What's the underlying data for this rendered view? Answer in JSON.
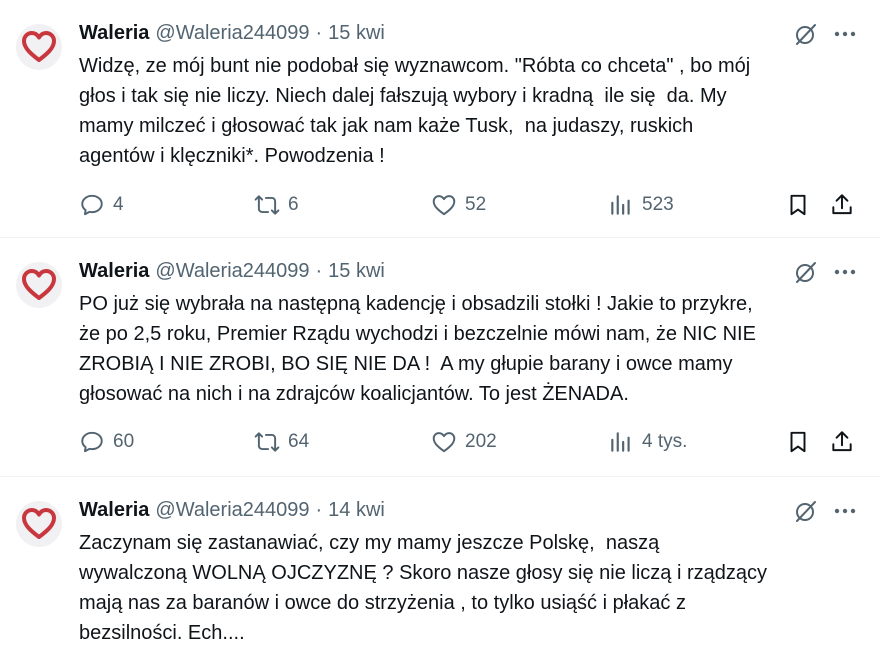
{
  "colors": {
    "text": "#0f1419",
    "muted": "#536471",
    "heart": "#c8373d",
    "divider": "#eff3f4"
  },
  "tweets": [
    {
      "name": "Waleria",
      "handle": "@Waleria244099",
      "separator": "·",
      "date": "15 kwi",
      "text": "Widzę, ze mój bunt nie podobał się wyznawcom. \"Róbta co chceta\" , bo mój\ngłos i tak się nie liczy. Niech dalej fałszują wybory i kradną  ile się  da. My\nmamy milczeć i głosować tak jak nam każe Tusk,  na judaszy, ruskich\nagentów i klęczniki*. Powodzenia !",
      "replies": "4",
      "reposts": "6",
      "likes": "52",
      "views": "523"
    },
    {
      "name": "Waleria",
      "handle": "@Waleria244099",
      "separator": "·",
      "date": "15 kwi",
      "text": "PO już się wybrała na następną kadencję i obsadzili stołki ! Jakie to przykre,\nże po 2,5 roku, Premier Rządu wychodzi i bezczelnie mówi nam, że NIC NIE\nZROBIĄ I NIE ZROBI, BO SIĘ NIE DA !  A my głupie barany i owce mamy\ngłosować na nich i na zdrajców koalicjantów. To jest ŻENADA.",
      "replies": "60",
      "reposts": "64",
      "likes": "202",
      "views": "4 tys."
    },
    {
      "name": "Waleria",
      "handle": "@Waleria244099",
      "separator": "·",
      "date": "14 kwi",
      "text": "Zaczynam się zastanawiać, czy my mamy jeszcze Polskę,  naszą\nwywalczoną WOLNĄ OJCZYZNĘ ? Skoro nasze głosy się nie liczą i rządzący\nmają nas za baranów i owce do strzyżenia , to tylko usiąść i płakać z\nbezsilności. Ech...."
    }
  ]
}
